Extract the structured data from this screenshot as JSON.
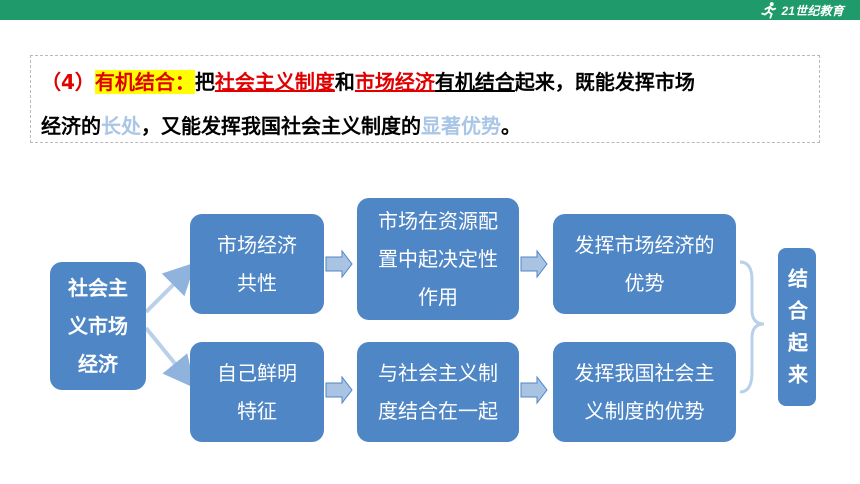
{
  "logo": {
    "text": "21世纪教育"
  },
  "statement": {
    "line1": {
      "number": "（4）",
      "term": "有机结合：",
      "word_ba": "把",
      "socialist_system": "社会主义制度",
      "word_he": "和",
      "market_economy": "市场经济",
      "organic_combine": "有机结合",
      "rest": "起来，既能发挥市场"
    },
    "line2": {
      "prefix": "经济的",
      "strengths": "长处",
      "middle": "，又能发挥我国社会主义制度的",
      "advantages": "显著优势",
      "end": "。"
    }
  },
  "diagram": {
    "root": {
      "line1": "社会主",
      "line2": "义市场",
      "line3": "经济"
    },
    "upper_1": {
      "line1": "市场经济",
      "line2": "共性"
    },
    "upper_2": {
      "line1": "市场在资源配",
      "line2": "置中起决定性",
      "line3": "作用"
    },
    "upper_3": {
      "line1": "发挥市场经济的",
      "line2": "优势"
    },
    "lower_1": {
      "line1": "自己鲜明",
      "line2": "特征"
    },
    "lower_2": {
      "line1": "与社会主义制",
      "line2": "度结合在一起"
    },
    "lower_3": {
      "line1": "发挥我国社会主",
      "line2": "义制度的优势"
    },
    "result": "结合起来"
  },
  "colors": {
    "brand_green": "#1f9a6a",
    "box_blue": "#4f86c6",
    "arrow_blue": "#8fb3dc",
    "highlight": "#ffff00",
    "accent_red": "#e00000"
  }
}
